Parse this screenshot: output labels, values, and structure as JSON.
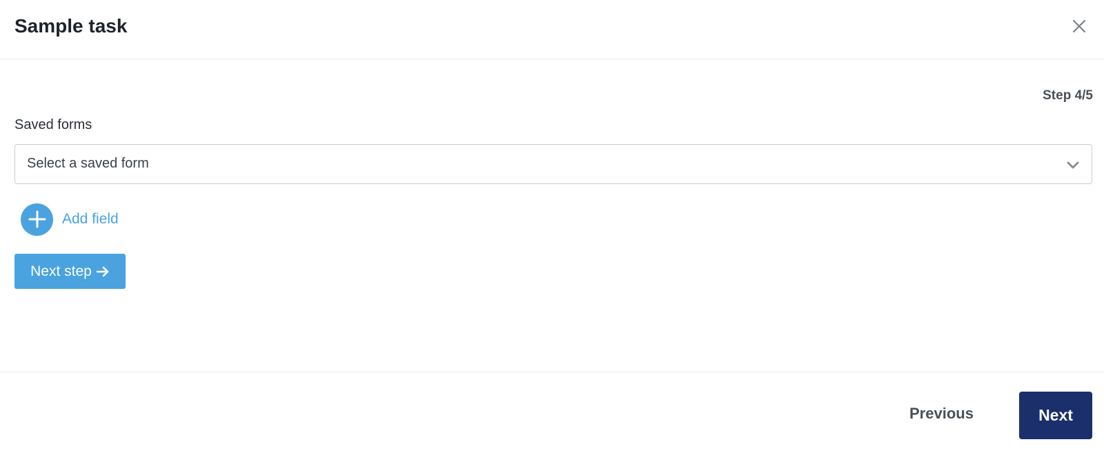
{
  "header": {
    "title": "Sample task",
    "close_icon": "close-icon"
  },
  "body": {
    "step_indicator": "Step 4/5",
    "saved_forms": {
      "label": "Saved forms",
      "selected_value": "Select a saved form",
      "chevron_icon": "chevron-down-icon"
    },
    "add_field": {
      "label": "Add field",
      "icon": "plus-icon"
    },
    "next_step": {
      "label": "Next step",
      "icon": "arrow-right-icon"
    }
  },
  "footer": {
    "previous_label": "Previous",
    "next_label": "Next"
  },
  "colors": {
    "accent": "#4aa3df",
    "primary": "#1a2f6b",
    "border": "#c9cbd6"
  }
}
